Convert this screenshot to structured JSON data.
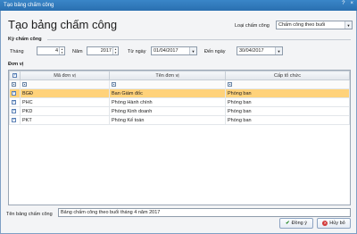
{
  "window": {
    "title": "Tạo bảng chấm công",
    "help_glyph": "?",
    "close_glyph": "×"
  },
  "heading": "Tạo bảng chấm công",
  "loai": {
    "label": "Loại chấm công",
    "value": "Chấm công theo buổi"
  },
  "ky": {
    "section_label": "Kỳ chấm công",
    "thang_label": "Tháng",
    "thang_value": "4",
    "nam_label": "Năm",
    "nam_value": "2017",
    "tungay_label": "Từ ngày",
    "tungay_value": "01/04/2017",
    "denngay_label": "Đến ngày",
    "denngay_value": "30/04/2017"
  },
  "donvi": {
    "section_label": "Đơn vị",
    "columns": [
      "Mã đơn vị",
      "Tên đơn vị",
      "Cấp tổ chức"
    ],
    "rows": [
      {
        "ma": "BGĐ",
        "ten": "Ban Giám đốc",
        "cap": "Phòng ban",
        "checked": true,
        "selected": true
      },
      {
        "ma": "PHC",
        "ten": "Phòng Hành chính",
        "cap": "Phòng ban",
        "checked": true,
        "selected": false
      },
      {
        "ma": "PKD",
        "ten": "Phòng Kinh doanh",
        "cap": "Phòng ban",
        "checked": true,
        "selected": false
      },
      {
        "ma": "PKT",
        "ten": "Phòng Kế toán",
        "cap": "Phòng ban",
        "checked": true,
        "selected": false
      }
    ]
  },
  "footer": {
    "ten_label": "Tên bảng chấm công",
    "ten_value": "Bảng chấm công theo buổi tháng 4 năm 2017",
    "ok_label": "Đồng ý",
    "cancel_label": "Hủy bỏ"
  },
  "colors": {
    "selected_row": "#ffd27a",
    "titlebar": "#2a6fb0"
  }
}
